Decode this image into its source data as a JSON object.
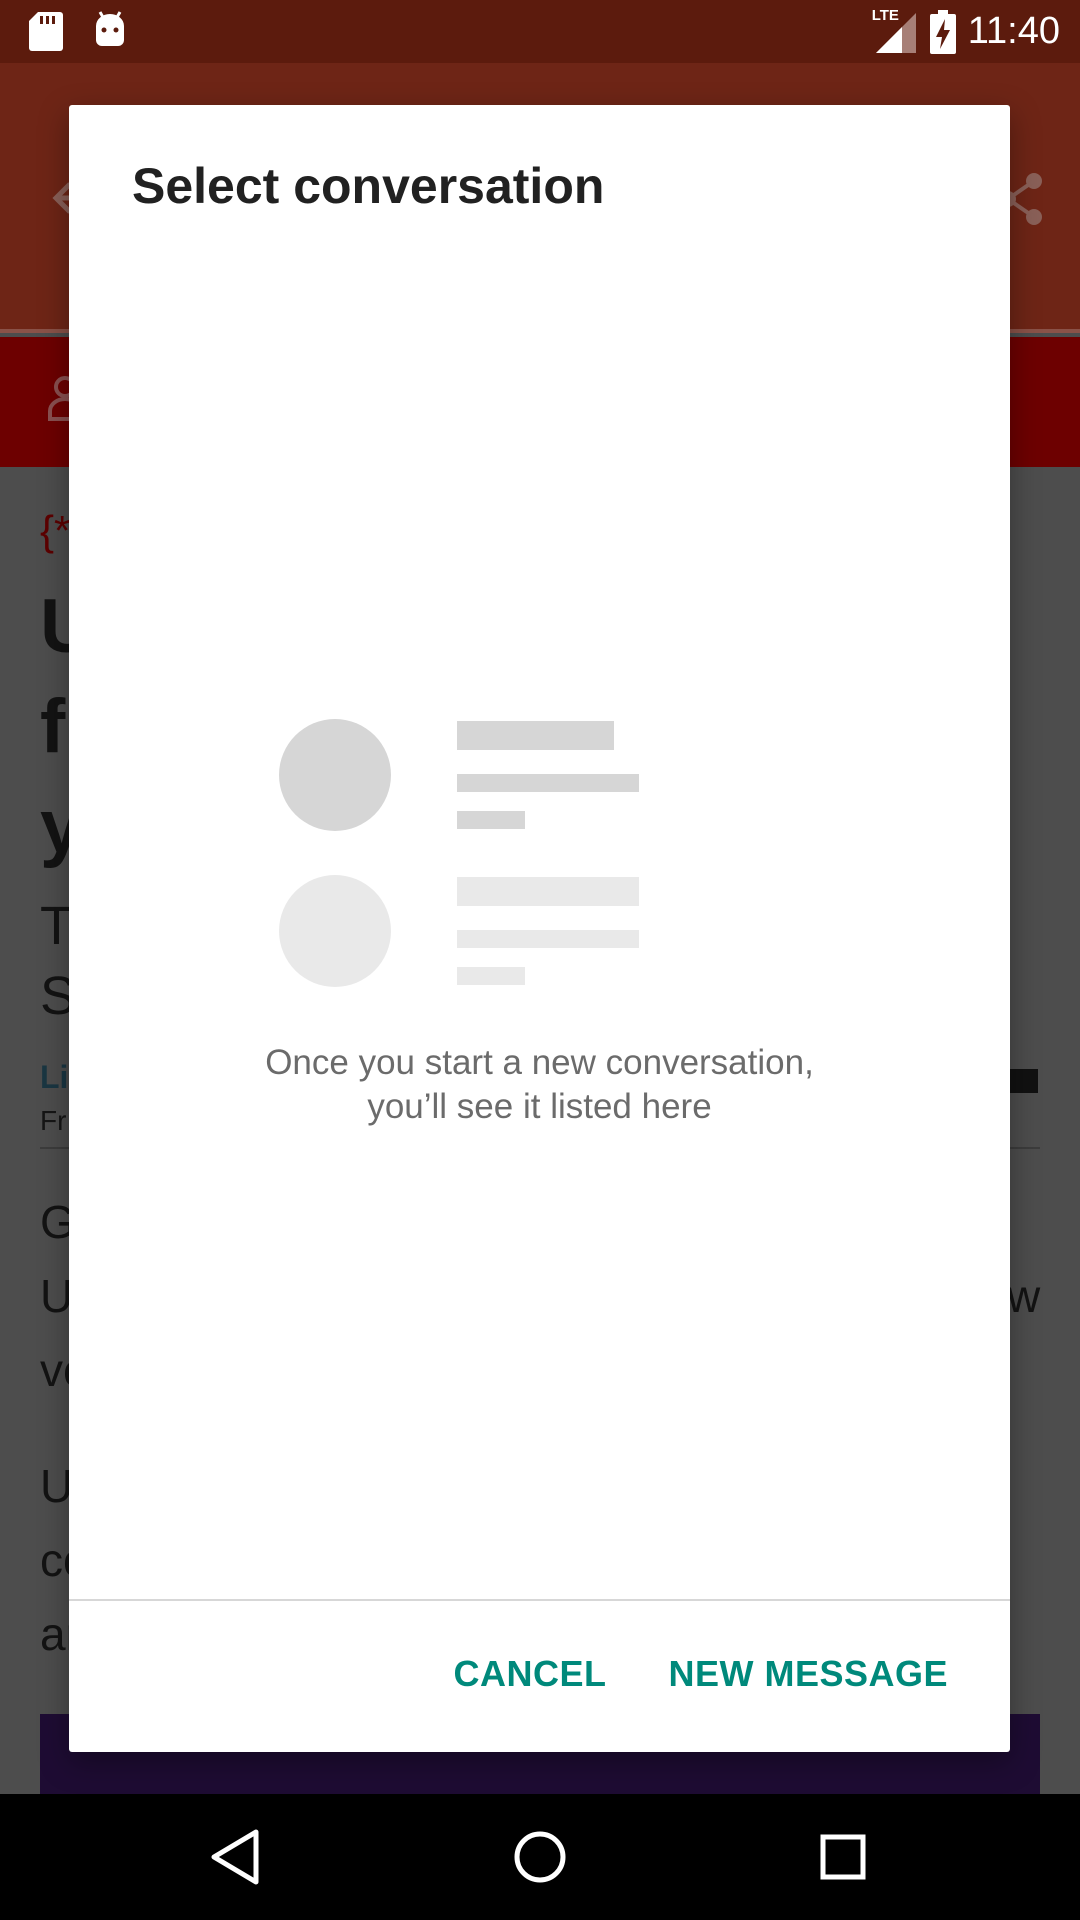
{
  "status_bar": {
    "time": "11:40",
    "network_label": "LTE",
    "left_icons": [
      "sd-card-icon",
      "android-icon"
    ],
    "right_icons": [
      "lte-signal-icon",
      "battery-charging-icon"
    ]
  },
  "background_app": {
    "toolbar_icons": [
      "back-arrow-icon",
      "share-icon"
    ],
    "tab_icons": [
      "user-icon"
    ],
    "article_fragments": {
      "brace": "{*",
      "headline_lines": [
        "U",
        "f",
        "y"
      ],
      "subtitle_lines": [
        "T",
        "S"
      ],
      "link": "Li",
      "byline": "Fr",
      "para1_lines": [
        "G",
        "U",
        "ve"
      ],
      "para1_right": "w",
      "para2_lines": [
        "U",
        "co",
        "ar"
      ]
    },
    "colors": {
      "status_bar": "#5c1b0d",
      "toolbar": "#6e2516",
      "tab_bar": "#6d0000"
    }
  },
  "dialog": {
    "title": "Select conversation",
    "empty_state": {
      "line1": "Once you start a new conversation,",
      "line2": "you’ll see it listed here"
    },
    "actions": {
      "cancel_label": "CANCEL",
      "new_message_label": "NEW MESSAGE"
    },
    "accent_color": "#00897b"
  },
  "nav_bar": {
    "buttons": [
      "back-triangle-icon",
      "home-circle-icon",
      "recents-square-icon"
    ]
  }
}
